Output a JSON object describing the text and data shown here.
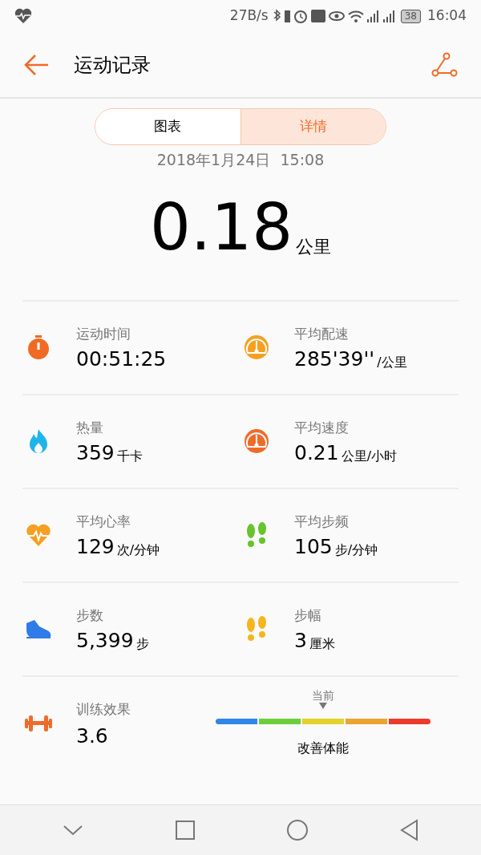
{
  "status_bar": {
    "speed": "27B/s",
    "battery": "38",
    "time": "16:04"
  },
  "header": {
    "title": "运动记录"
  },
  "tabs": [
    {
      "label": "图表",
      "selected": false
    },
    {
      "label": "详情",
      "selected": true
    }
  ],
  "date": "2018年1月24日  15:08",
  "distance": {
    "value": "0.18",
    "unit": "公里"
  },
  "stats": [
    [
      {
        "kind": "stopwatch",
        "label": "运动时间",
        "value": "00:51:25"
      },
      {
        "kind": "gauge-orange",
        "label": "平均配速",
        "value": "285'39''",
        "unit": "/公里"
      }
    ],
    [
      {
        "kind": "flame",
        "label": "热量",
        "value": "359",
        "unit": "千卡"
      },
      {
        "kind": "gauge-red",
        "label": "平均速度",
        "value": "0.21",
        "unit": "公里/小时"
      }
    ],
    [
      {
        "kind": "heart",
        "label": "平均心率",
        "value": "129",
        "unit": "次/分钟"
      },
      {
        "kind": "footprints-green",
        "label": "平均步频",
        "value": "105",
        "unit": "步/分钟"
      }
    ],
    [
      {
        "kind": "shoe",
        "label": "步数",
        "value": "5,399",
        "unit": "步"
      },
      {
        "kind": "footprints-yellow",
        "label": "步幅",
        "value": "3",
        "unit": "厘米"
      }
    ]
  ],
  "training": {
    "label": "训练效果",
    "value": "3.6",
    "marker_label": "当前",
    "result": "改善体能",
    "segments": [
      {
        "color": "#2f86e8"
      },
      {
        "color": "#6ccf3a"
      },
      {
        "color": "#e4d12c"
      },
      {
        "color": "#eca431"
      },
      {
        "color": "#ec3a2c"
      }
    ]
  }
}
